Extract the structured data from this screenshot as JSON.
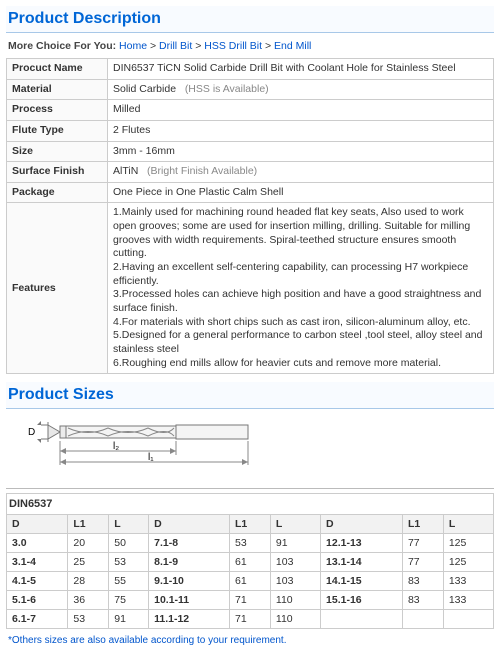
{
  "titles": {
    "desc": "Product Description",
    "sizes": "Product Sizes"
  },
  "breadcrumb": {
    "label": "More Choice For You:",
    "home": "Home",
    "p1": "Drill Bit",
    "p2": "HSS Drill Bit",
    "p3": "End Mill",
    "sep": ">"
  },
  "spec": {
    "k_name": "Procuct Name",
    "v_name": "DIN6537 TiCN Solid Carbide Drill Bit with Coolant Hole for Stainless Steel",
    "k_mat": "Material",
    "v_mat": "Solid Carbide",
    "v_mat_note": "(HSS is Available)",
    "k_proc": "Process",
    "v_proc": "Milled",
    "k_flute": "Flute Type",
    "v_flute": "2 Flutes",
    "k_size": "Size",
    "v_size": "3mm - 16mm",
    "k_sf": "Surface Finish",
    "v_sf": "AlTiN",
    "v_sf_note": "(Bright Finish Available)",
    "k_pkg": "Package",
    "v_pkg": "One Piece in One Plastic Calm Shell",
    "k_feat": "Features",
    "feat1": "1.Mainly used for machining round headed flat key seats, Also used to work open grooves; some are used for insertion milling, drilling. Suitable for milling grooves with width requirements. Spiral-teethed structure ensures smooth cutting.",
    "feat2": "2.Having an excellent self-centering capability, can processing H7 workpiece efficiently.",
    "feat3": "3.Processed holes can achieve high position and have a good straightness and surface finish.",
    "feat4": "4.For materials with short chips such as cast iron, silicon-aluminum alloy, etc.",
    "feat5": "5.Designed for a general performance to carbon steel ,tool steel, alloy steel and stainless steel",
    "feat6": "6.Roughing end mills allow for heavier cuts and remove more material."
  },
  "diagram": {
    "D": "D",
    "l1": "l₁",
    "l2": "l₂"
  },
  "sizes": {
    "din": "DIN6537",
    "hD": "D",
    "hL1": "L1",
    "hL": "L",
    "r": [
      [
        "3.0",
        "20",
        "50",
        "7.1-8",
        "53",
        "91",
        "12.1-13",
        "77",
        "125"
      ],
      [
        "3.1-4",
        "25",
        "53",
        "8.1-9",
        "61",
        "103",
        "13.1-14",
        "77",
        "125"
      ],
      [
        "4.1-5",
        "28",
        "55",
        "9.1-10",
        "61",
        "103",
        "14.1-15",
        "83",
        "133"
      ],
      [
        "5.1-6",
        "36",
        "75",
        "10.1-11",
        "71",
        "110",
        "15.1-16",
        "83",
        "133"
      ],
      [
        "6.1-7",
        "53",
        "91",
        "11.1-12",
        "71",
        "110",
        "",
        "",
        ""
      ]
    ]
  },
  "footnote": "*Others sizes are also available according to your requirement."
}
